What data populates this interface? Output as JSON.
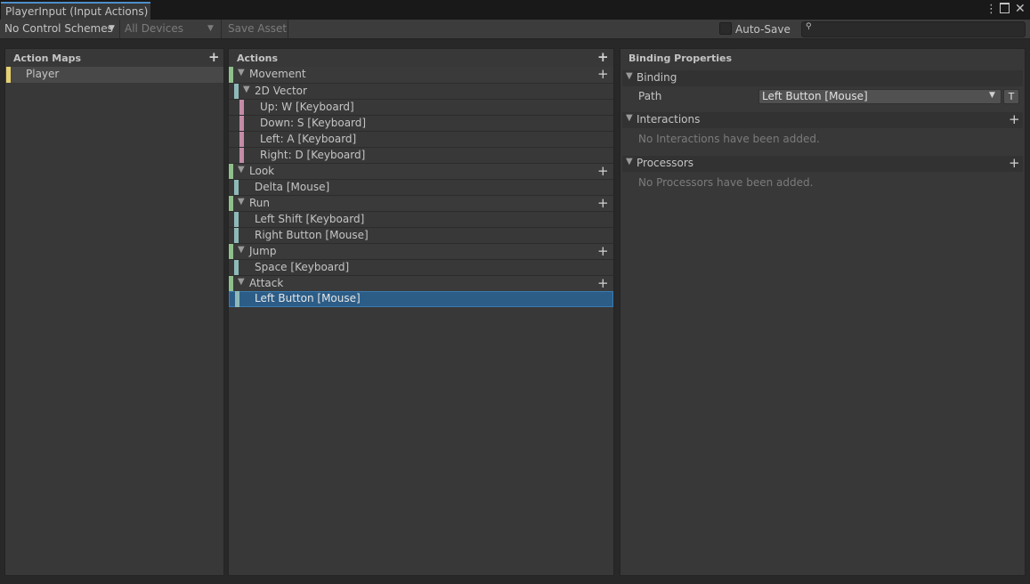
{
  "window": {
    "title": "PlayerInput (Input Actions)"
  },
  "toolbar": {
    "control_schemes": "No Control Schemes",
    "devices": "All Devices",
    "save_asset": "Save Asset",
    "auto_save": "Auto-Save",
    "search_placeholder": ""
  },
  "action_maps": {
    "title": "Action Maps",
    "items": [
      "Player"
    ]
  },
  "actions": {
    "title": "Actions",
    "movement": "Movement",
    "vector2d": "2D Vector",
    "up": "Up: W [Keyboard]",
    "down": "Down: S [Keyboard]",
    "left": "Left: A [Keyboard]",
    "right": "Right: D [Keyboard]",
    "look": "Look",
    "delta": "Delta [Mouse]",
    "run": "Run",
    "left_shift": "Left Shift [Keyboard]",
    "right_button": "Right Button [Mouse]",
    "jump": "Jump",
    "space": "Space [Keyboard]",
    "attack": "Attack",
    "left_button": "Left Button [Mouse]"
  },
  "binding_properties": {
    "title": "Binding Properties",
    "binding_label": "Binding",
    "path_label": "Path",
    "path_value": "Left Button [Mouse]",
    "t_button": "T",
    "interactions_label": "Interactions",
    "interactions_empty": "No Interactions have been added.",
    "processors_label": "Processors",
    "processors_empty": "No Processors have been added."
  },
  "colors": {
    "accent_selected": "#2c5d87",
    "action_bar": "#8fc08b",
    "binding_bar": "#8fb9b9",
    "composite_part_bar": "#c48ba6",
    "action_map_bar": "#e6d070"
  }
}
